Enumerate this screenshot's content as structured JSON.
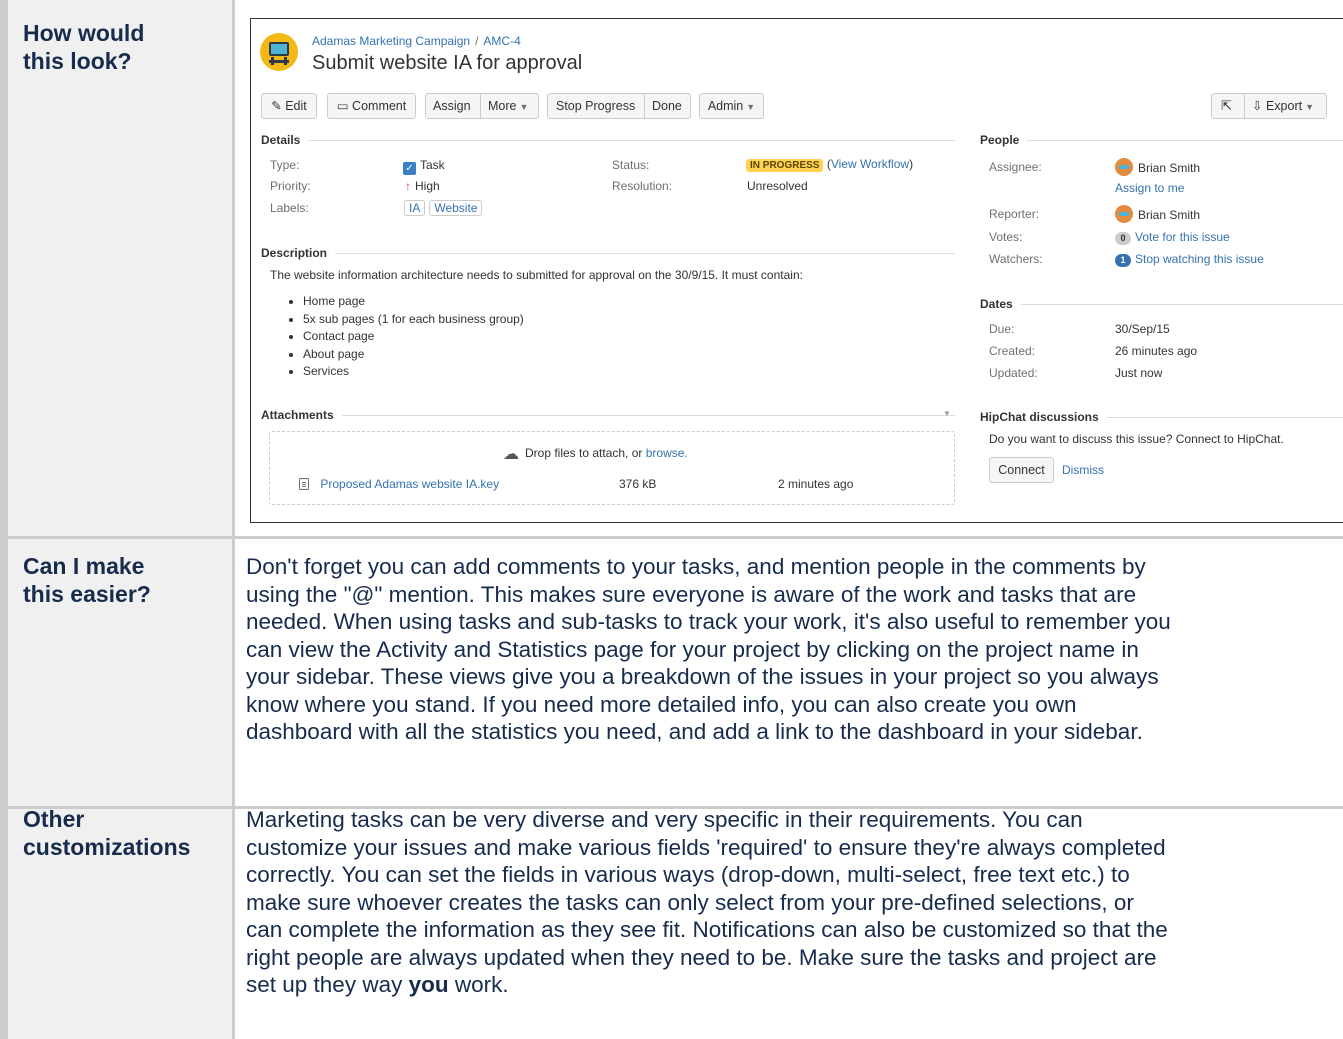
{
  "rows": [
    {
      "header_line1": "How would",
      "header_line2": "this look?"
    },
    {
      "header_line1": "Can I make",
      "header_line2": "this easier?",
      "body_lines": [
        "Don't forget you can add comments to your tasks, and mention people in the comments by",
        "using the \"@\" mention. This makes sure everyone is aware of the work and tasks that are",
        "needed. When using tasks and sub-tasks to track your work, it's also useful to remember you",
        "can view the Activity and Statistics page for your project by clicking on the project name in",
        "your sidebar. These views give you a breakdown of the issues in your project so you always",
        "know where you stand. If you need more detailed info, you can also create you own",
        "dashboard with all the statistics you need, and add a link to the dashboard in your sidebar."
      ]
    },
    {
      "header_line1": "Other",
      "header_line2": "customizations",
      "body_lines": [
        "Marketing tasks can be very diverse and very specific in their requirements. You can",
        "customize your issues and make various fields 'required' to ensure they're always completed",
        "correctly. You can set the fields in various ways (drop-down, multi-select, free text etc.) to",
        "make sure whoever creates the tasks can only select from your pre-defined selections, or",
        "can complete the information as they see fit. Notifications can also be customized so that the",
        "right people are always updated when they need to be. Make sure the tasks and project are"
      ],
      "last_line_before": "set up they way ",
      "last_line_bold": "you",
      "last_line_after": " work."
    }
  ],
  "issue": {
    "project": "Adamas Marketing Campaign",
    "separator": "/",
    "key": "AMC-4",
    "title": "Submit website IA for approval",
    "toolbar": {
      "edit": "Edit",
      "comment": "Comment",
      "assign": "Assign",
      "more": "More",
      "stop_progress": "Stop Progress",
      "done": "Done",
      "admin": "Admin",
      "export": "Export"
    },
    "details": {
      "heading": "Details",
      "type_label": "Type:",
      "type_value": "Task",
      "priority_label": "Priority:",
      "priority_value": "High",
      "labels_label": "Labels:",
      "labels": [
        "IA",
        "Website"
      ],
      "status_label": "Status:",
      "status_value": "IN PROGRESS",
      "view_workflow": "View Workflow",
      "resolution_label": "Resolution:",
      "resolution_value": "Unresolved"
    },
    "description": {
      "heading": "Description",
      "text": "The website information architecture needs to submitted for approval on the 30/9/15. It must contain:",
      "items": [
        "Home page",
        "5x sub pages (1 for each business group)",
        "Contact page",
        "About page",
        "Services"
      ]
    },
    "attachments": {
      "heading": "Attachments",
      "drop_text": "Drop files to attach, or ",
      "browse": "browse.",
      "file_name": "Proposed Adamas website IA.key",
      "file_size": "376 kB",
      "file_time": "2 minutes ago"
    },
    "people": {
      "heading": "People",
      "assignee_label": "Assignee:",
      "assignee": "Brian Smith",
      "assign_to_me": "Assign to me",
      "reporter_label": "Reporter:",
      "reporter": "Brian Smith",
      "votes_label": "Votes:",
      "votes_count": "0",
      "vote_link": "Vote for this issue",
      "watchers_label": "Watchers:",
      "watchers_count": "1",
      "watch_link": "Stop watching this issue"
    },
    "dates": {
      "heading": "Dates",
      "due_label": "Due:",
      "due": "30/Sep/15",
      "created_label": "Created:",
      "created": "26 minutes ago",
      "updated_label": "Updated:",
      "updated": "Just now"
    },
    "hipchat": {
      "heading": "HipChat discussions",
      "text": "Do you want to discuss this issue? Connect to HipChat.",
      "connect": "Connect",
      "dismiss": "Dismiss"
    }
  }
}
